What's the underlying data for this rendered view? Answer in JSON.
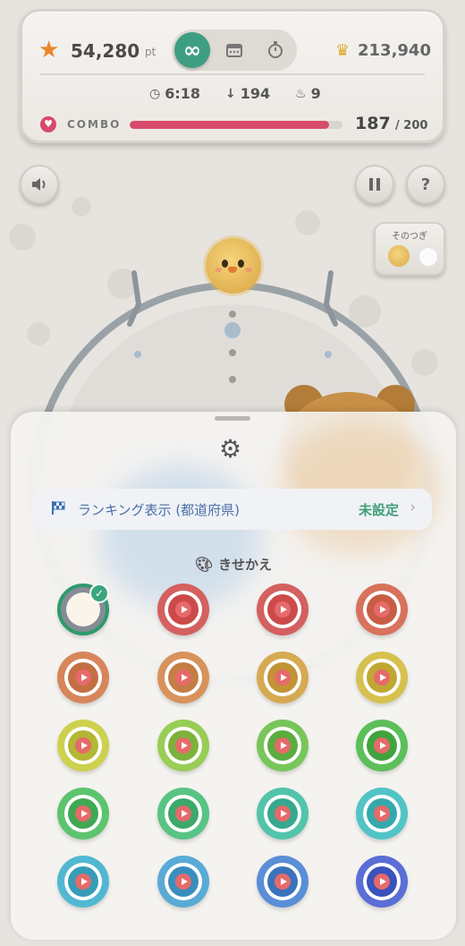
{
  "hud": {
    "score": "54,280",
    "score_unit": "pt",
    "mode_icons": [
      "infinity-icon",
      "calendar-icon",
      "stopwatch-icon"
    ],
    "mode_active": "∞",
    "best_score": "213,940",
    "time": "6:18",
    "drops": "194",
    "flames": "9",
    "combo_label": "COMBO",
    "combo_current": "187",
    "combo_max": "/ 200",
    "combo_progress": 0.935
  },
  "controls": {
    "sound_icon": "speaker-icon",
    "pause_icon": "pause-icon",
    "help_label": "?"
  },
  "next": {
    "label": "そのつぎ"
  },
  "sheet": {
    "ranking_label": "ランキング表示 (都道府県)",
    "ranking_value": "未設定",
    "skin_title": "きせかえ"
  },
  "skins": [
    {
      "ring": "#868c96",
      "core": "#fbf4ea",
      "selected": true
    },
    {
      "ring": "#d46060",
      "core": "#cc4a4a"
    },
    {
      "ring": "#d46060",
      "core": "#cc4a4a"
    },
    {
      "ring": "#d8725c",
      "core": "#c85c44"
    },
    {
      "ring": "#d8855c",
      "core": "#c46e44"
    },
    {
      "ring": "#d8935c",
      "core": "#c47e44"
    },
    {
      "ring": "#d6aa52",
      "core": "#c29436"
    },
    {
      "ring": "#d7c14e",
      "core": "#c0a732"
    },
    {
      "ring": "#cdd14e",
      "core": "#b3b734"
    },
    {
      "ring": "#98cd56",
      "core": "#7cb23a"
    },
    {
      "ring": "#78c65a",
      "core": "#5aad3e"
    },
    {
      "ring": "#5cbf5a",
      "core": "#41a33e"
    },
    {
      "ring": "#5dc46e",
      "core": "#3fa852"
    },
    {
      "ring": "#58c484",
      "core": "#3ca86a"
    },
    {
      "ring": "#52c4aa",
      "core": "#36a890"
    },
    {
      "ring": "#52c4c6",
      "core": "#36a8ab"
    },
    {
      "ring": "#52b8d2",
      "core": "#369cb8"
    },
    {
      "ring": "#5aaad6",
      "core": "#3a8ebd"
    },
    {
      "ring": "#5a8ed6",
      "core": "#3a72bd"
    },
    {
      "ring": "#5a6ed6",
      "core": "#3a52bd"
    }
  ]
}
